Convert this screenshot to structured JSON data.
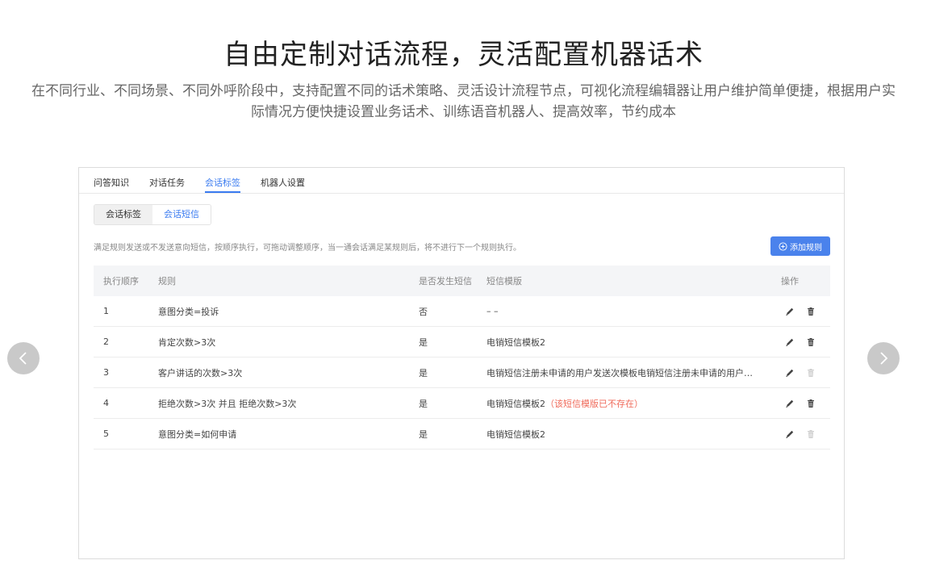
{
  "hero": {
    "title": "自由定制对话流程，灵活配置机器话术",
    "subtitle_line1": "在不同行业、不同场景、不同外呼阶段中，支持配置不同的话术策略、灵活设计流程节点，可视化流程编辑器让用户维护简单便捷，根据用户实",
    "subtitle_line2": "际情况方便快捷设置业务话术、训练语音机器人、提高效率，节约成本"
  },
  "tabs": [
    "问答知识",
    "对话任务",
    "会话标签",
    "机器人设置"
  ],
  "active_tab": "会话标签",
  "segments": [
    "会话标签",
    "会话短信"
  ],
  "active_segment": "会话短信",
  "description": "满足规则发送或不发送意向短信，按顺序执行，可拖动调整顺序，当一通会话满足某规则后，将不进行下一个规则执行。",
  "add_button": "添加规则",
  "table": {
    "headers": [
      "执行顺序",
      "规则",
      "是否发生短信",
      "短信模版",
      "操作"
    ],
    "rows": [
      {
        "order": "1",
        "rule": "意图分类=投诉",
        "send": "否",
        "template": "– –",
        "warning": "",
        "delete_enabled": true
      },
      {
        "order": "2",
        "rule": "肯定次数>3次",
        "send": "是",
        "template": "电销短信模板2",
        "warning": "",
        "delete_enabled": true
      },
      {
        "order": "3",
        "rule": "客户讲话的次数>3次",
        "send": "是",
        "template": "电销短信注册未申请的用户发送次模板电销短信注册未申请的用户发...",
        "warning": "",
        "delete_enabled": false
      },
      {
        "order": "4",
        "rule": "拒绝次数>3次 并且 拒绝次数>3次",
        "send": "是",
        "template": "电销短信模板2",
        "warning": "（该短信模版已不存在）",
        "delete_enabled": true
      },
      {
        "order": "5",
        "rule": "意图分类=如何申请",
        "send": "是",
        "template": "电销短信模板2",
        "warning": "",
        "delete_enabled": false
      }
    ]
  },
  "colors": {
    "accent": "#3a7bf0",
    "warning": "#f06b5b",
    "nav_button": "#c9c9c9"
  },
  "icons": {
    "prev": "chevron-left-icon",
    "next": "chevron-right-icon",
    "edit": "pencil-icon",
    "delete": "trash-icon",
    "add": "plus-circle-icon"
  }
}
